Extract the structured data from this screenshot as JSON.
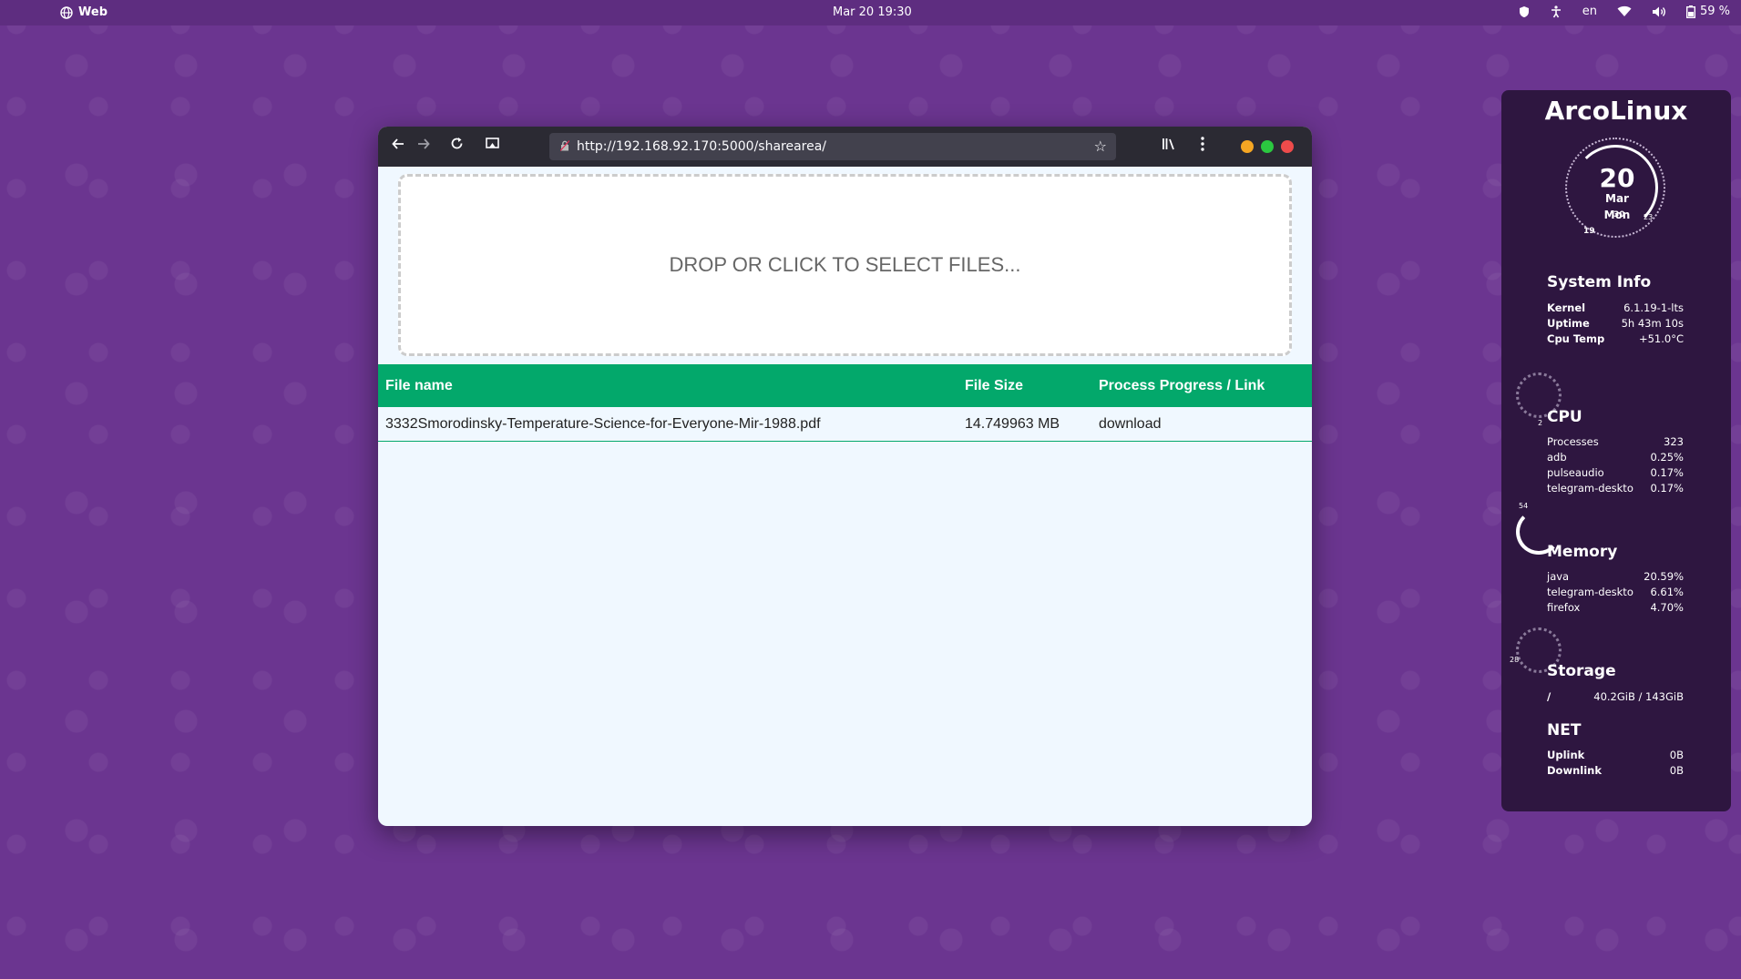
{
  "topbar": {
    "app_name": "Web",
    "clock": "Mar 20  19:30",
    "language": "en",
    "battery": "59 %"
  },
  "browser": {
    "url": "http://192.168.92.170:5000/sharearea/"
  },
  "page": {
    "dropzone_text": "DROP OR CLICK TO SELECT FILES...",
    "table": {
      "headers": [
        "File name",
        "File Size",
        "Process Progress / Link"
      ],
      "rows": [
        {
          "name": "3332Smorodinsky-Temperature-Science-for-Everyone-Mir-1988.pdf",
          "size": "14.749963 MB",
          "link": "download"
        }
      ]
    }
  },
  "conky": {
    "title": "ArcoLinux",
    "date": {
      "day": "20",
      "month": "Mar",
      "weekday": "Mon",
      "tick_left": "19",
      "tick_mid": "30",
      "tick_right": "23"
    },
    "system_info": {
      "heading": "System Info",
      "rows": [
        {
          "k": "Kernel",
          "v": "6.1.19-1-lts"
        },
        {
          "k": "Uptime",
          "v": "5h 43m 10s"
        },
        {
          "k": "Cpu Temp",
          "v": "+51.0°C"
        }
      ]
    },
    "cpu": {
      "heading": "CPU",
      "gauge_label": "2",
      "rows": [
        {
          "k": "Processes",
          "v": "323"
        },
        {
          "k": "adb",
          "v": "0.25%"
        },
        {
          "k": "pulseaudio",
          "v": "0.17%"
        },
        {
          "k": "telegram-deskto",
          "v": "0.17%"
        }
      ]
    },
    "memory": {
      "heading": "Memory",
      "gauge_label": "54",
      "rows": [
        {
          "k": "java",
          "v": "20.59%"
        },
        {
          "k": "telegram-deskto",
          "v": "6.61%"
        },
        {
          "k": "firefox",
          "v": "4.70%"
        }
      ]
    },
    "storage": {
      "heading": "Storage",
      "gauge_label": "28",
      "rows": [
        {
          "k": "/",
          "v": "40.2GiB / 143GiB"
        }
      ]
    },
    "net": {
      "heading": "NET",
      "rows": [
        {
          "k": "Uplink",
          "v": "0B"
        },
        {
          "k": "Downlink",
          "v": "0B"
        }
      ]
    }
  }
}
